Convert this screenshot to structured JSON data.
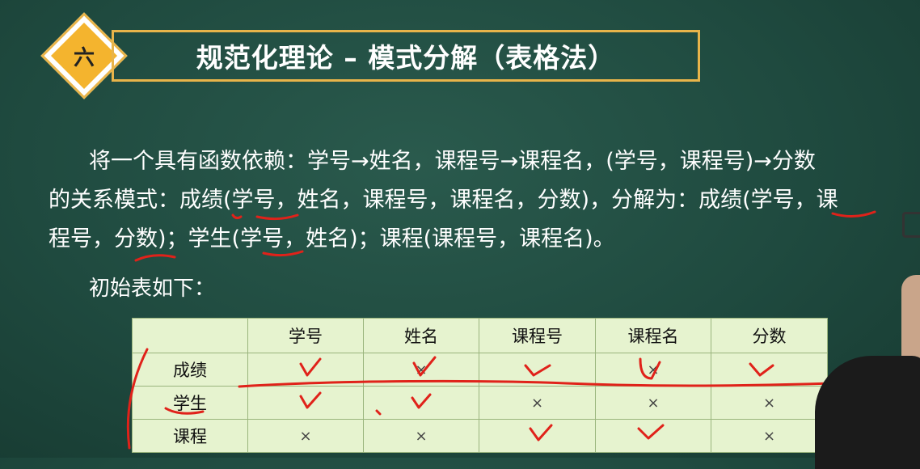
{
  "slide": {
    "badge": "六",
    "title": "规范化理论 – 模式分解（表格法）",
    "paragraph": {
      "line1": "将一个具有函数依赖：学号→姓名，课程号→课程名，(学号，课程号)→分数",
      "line2": "的关系模式：成绩(学号，姓名，课程号，课程名，分数)，分解为：成绩(学号，课",
      "line3": "程号，分数)；学生(学号，姓名)；课程(课程号，课程名)。"
    },
    "intro": "初始表如下："
  },
  "table": {
    "columns": [
      "",
      "学号",
      "姓名",
      "课程号",
      "课程名",
      "分数"
    ],
    "rows": [
      {
        "label": "成绩",
        "cells": [
          "",
          "×",
          "",
          "×",
          ""
        ]
      },
      {
        "label": "学生",
        "cells": [
          "",
          "",
          "×",
          "×",
          "×"
        ]
      },
      {
        "label": "课程",
        "cells": [
          "×",
          "×",
          "",
          "",
          "×"
        ]
      }
    ]
  },
  "colors": {
    "board": "#1f4a3f",
    "accent": "#e8b44a",
    "table_bg": "#e6f3cf",
    "ink": "#e0221a"
  }
}
